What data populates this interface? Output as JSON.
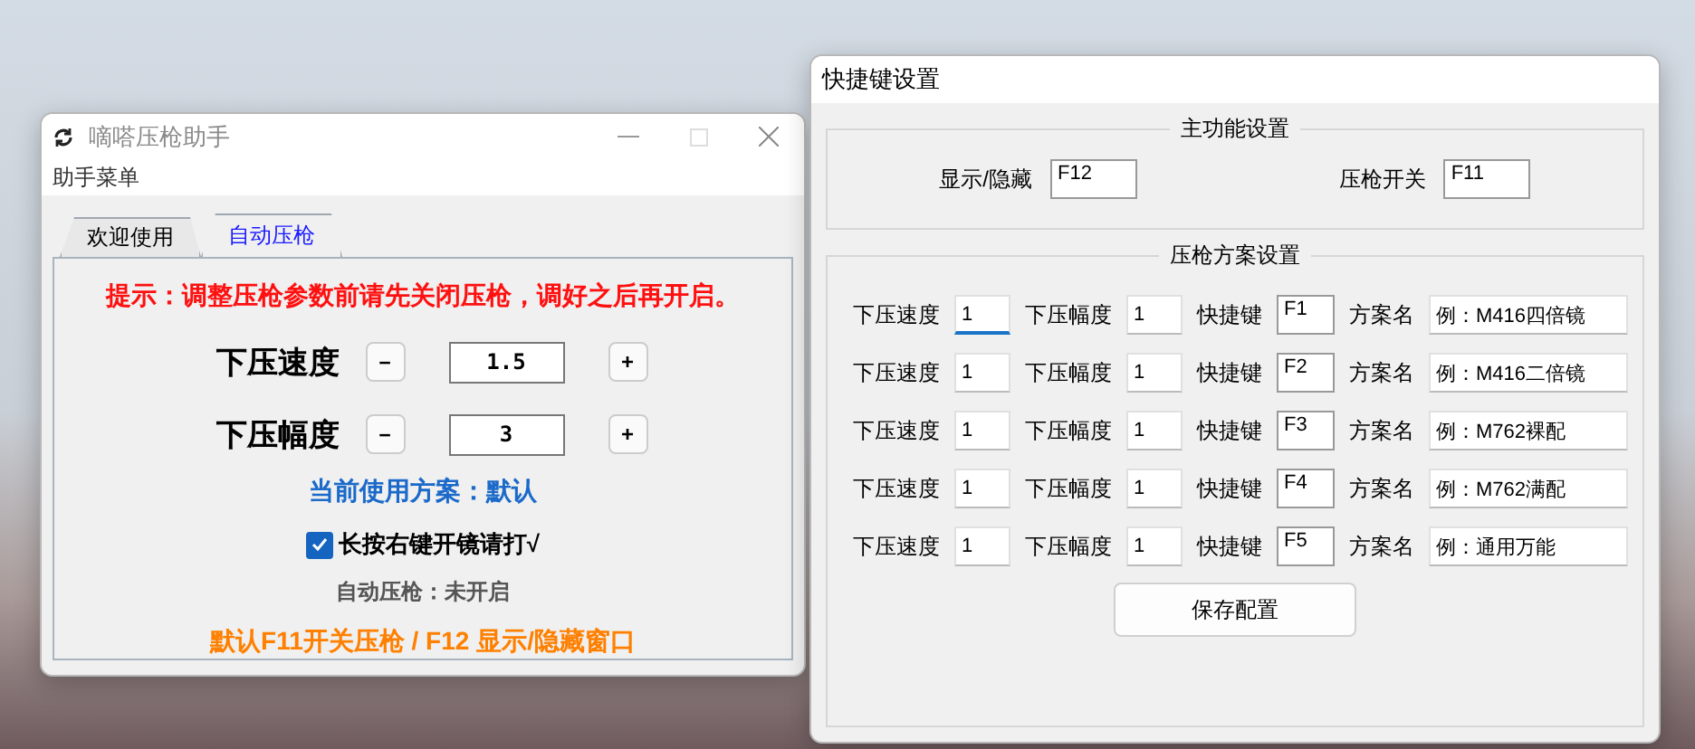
{
  "main_window": {
    "title": "嘀嗒压枪助手",
    "menu": [
      "助手菜单"
    ],
    "tabs": [
      {
        "label": "欢迎使用",
        "selected": false
      },
      {
        "label": "自动压枪",
        "selected": true
      }
    ],
    "hint": "提示：调整压枪参数前请先关闭压枪，调好之后再开启。",
    "steppers": [
      {
        "label": "下压速度",
        "minus": "－",
        "value": "1.5",
        "plus": "+"
      },
      {
        "label": "下压幅度",
        "minus": "－",
        "value": "3",
        "plus": "+"
      }
    ],
    "current_scheme": "当前使用方案：默认",
    "checkbox": {
      "label": "长按右键开镜请打√",
      "checked": true
    },
    "status": "自动压枪：未开启",
    "footer": "默认F11开关压枪 / F12 显示/隐藏窗口"
  },
  "hotkey_window": {
    "title": "快捷键设置",
    "main_group": {
      "title": "主功能设置",
      "fields": [
        {
          "label": "显示/隐藏",
          "value": "F12"
        },
        {
          "label": "压枪开关",
          "value": "F11"
        }
      ]
    },
    "scheme_group": {
      "title": "压枪方案设置",
      "rows": [
        {
          "speed_label": "下压速度",
          "speed": "1",
          "focused": true,
          "amp_label": "下压幅度",
          "amp": "1",
          "key_label": "快捷键",
          "key": "F1",
          "name_label": "方案名",
          "name": "例：M416四倍镜"
        },
        {
          "speed_label": "下压速度",
          "speed": "1",
          "focused": false,
          "amp_label": "下压幅度",
          "amp": "1",
          "key_label": "快捷键",
          "key": "F2",
          "name_label": "方案名",
          "name": "例：M416二倍镜"
        },
        {
          "speed_label": "下压速度",
          "speed": "1",
          "focused": false,
          "amp_label": "下压幅度",
          "amp": "1",
          "key_label": "快捷键",
          "key": "F3",
          "name_label": "方案名",
          "name": "例：M762裸配"
        },
        {
          "speed_label": "下压速度",
          "speed": "1",
          "focused": false,
          "amp_label": "下压幅度",
          "amp": "1",
          "key_label": "快捷键",
          "key": "F4",
          "name_label": "方案名",
          "name": "例：M762满配"
        },
        {
          "speed_label": "下压速度",
          "speed": "1",
          "focused": false,
          "amp_label": "下压幅度",
          "amp": "1",
          "key_label": "快捷键",
          "key": "F5",
          "name_label": "方案名",
          "name": "例：通用万能"
        }
      ],
      "save": "保存配置"
    }
  }
}
